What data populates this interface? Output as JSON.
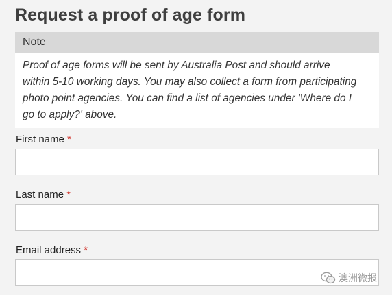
{
  "page": {
    "title": "Request a proof of age form"
  },
  "note": {
    "header": "Note",
    "lines": [
      "Proof of age forms will be sent by Australia Post and should arrive",
      "within 5-10 working days. You may also collect a form from participating",
      "photo point agencies. You can find a list of agencies under 'Where do I",
      "go to apply?' above."
    ]
  },
  "fields": [
    {
      "label": "First name",
      "required_marker": "*",
      "value": "",
      "placeholder": ""
    },
    {
      "label": "Last name",
      "required_marker": "*",
      "value": "",
      "placeholder": ""
    },
    {
      "label": "Email address",
      "required_marker": "*",
      "value": "",
      "placeholder": ""
    }
  ],
  "watermark": {
    "text": "澳洲微报",
    "icon": "wechat-icon"
  },
  "colors": {
    "background": "#f3f3f3",
    "note_header_bg": "#d8d8d8",
    "required_marker": "#d0322a",
    "title_text": "#3f3f3f"
  }
}
